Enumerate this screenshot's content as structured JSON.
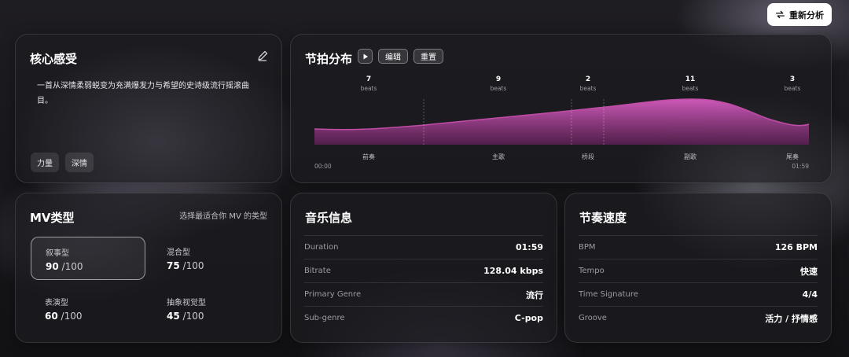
{
  "header": {
    "reanalyze_label": "重新分析"
  },
  "core": {
    "title": "核心感受",
    "description": "一首从深情柔弱蜕变为充满爆发力与希望的史诗级流行摇滚曲目。",
    "tags": [
      "力量",
      "深情"
    ]
  },
  "beats": {
    "title": "节拍分布",
    "edit_label": "编辑",
    "reset_label": "重置",
    "start_time": "00:00",
    "end_time": "01:59",
    "beat_unit": "beats",
    "sections": [
      {
        "label": "前奏",
        "beats": "7"
      },
      {
        "label": "主歌",
        "beats": "9"
      },
      {
        "label": "桥段",
        "beats": "2"
      },
      {
        "label": "副歌",
        "beats": "11"
      },
      {
        "label": "尾奏",
        "beats": "3"
      }
    ],
    "accent_color": "#c04ca6"
  },
  "mv": {
    "title": "MV类型",
    "hint": "选择最适合你 MV 的类型",
    "score_suffix": "/100",
    "types": [
      {
        "name": "叙事型",
        "score": "90",
        "selected": true
      },
      {
        "name": "混合型",
        "score": "75",
        "selected": false
      },
      {
        "name": "表演型",
        "score": "60",
        "selected": false
      },
      {
        "name": "抽象视觉型",
        "score": "45",
        "selected": false
      }
    ]
  },
  "music_info": {
    "title": "音乐信息",
    "rows": [
      {
        "key": "Duration",
        "value": "01:59"
      },
      {
        "key": "Bitrate",
        "value": "128.04 kbps"
      },
      {
        "key": "Primary Genre",
        "value": "流行"
      },
      {
        "key": "Sub-genre",
        "value": "C-pop"
      }
    ]
  },
  "rhythm": {
    "title": "节奏速度",
    "rows": [
      {
        "key": "BPM",
        "value": "126 BPM"
      },
      {
        "key": "Tempo",
        "value": "快速"
      },
      {
        "key": "Time Signature",
        "value": "4/4"
      },
      {
        "key": "Groove",
        "value": "活力 / 抒情感"
      }
    ]
  }
}
